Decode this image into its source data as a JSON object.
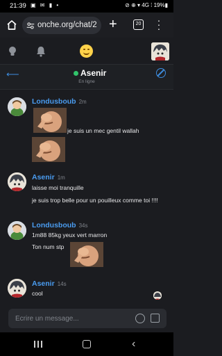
{
  "status_bar": {
    "time": "21:39",
    "notifications": "▣ ✉ ▮ •",
    "right": "⊘ ⊕ ▾ 4G ⁞ 19%▮"
  },
  "browser": {
    "url": "onche.org/chat/2",
    "tab_count": "20"
  },
  "chat": {
    "contact_name": "Asenir",
    "contact_status": "En ligne"
  },
  "messages": [
    {
      "author": "Londusboub",
      "time": "2m",
      "lines": [
        "je suis un mec gentil wallah"
      ]
    },
    {
      "author": "Asenir",
      "time": "1m",
      "lines": [
        "laisse moi tranquille",
        "je suis trop belle pour un pouilleux comme toi !!!!"
      ]
    },
    {
      "author": "Londusboub",
      "time": "34s",
      "lines": [
        "1m88 85kg yeux vert marron",
        "Ton num stp"
      ]
    },
    {
      "author": "Asenir",
      "time": "14s",
      "lines": [
        "cool"
      ]
    }
  ],
  "composer": {
    "placeholder": "Écrire un message..."
  },
  "colors": {
    "accent": "#4a9cf0",
    "background": "#1b1c20",
    "online": "#31c46b"
  }
}
